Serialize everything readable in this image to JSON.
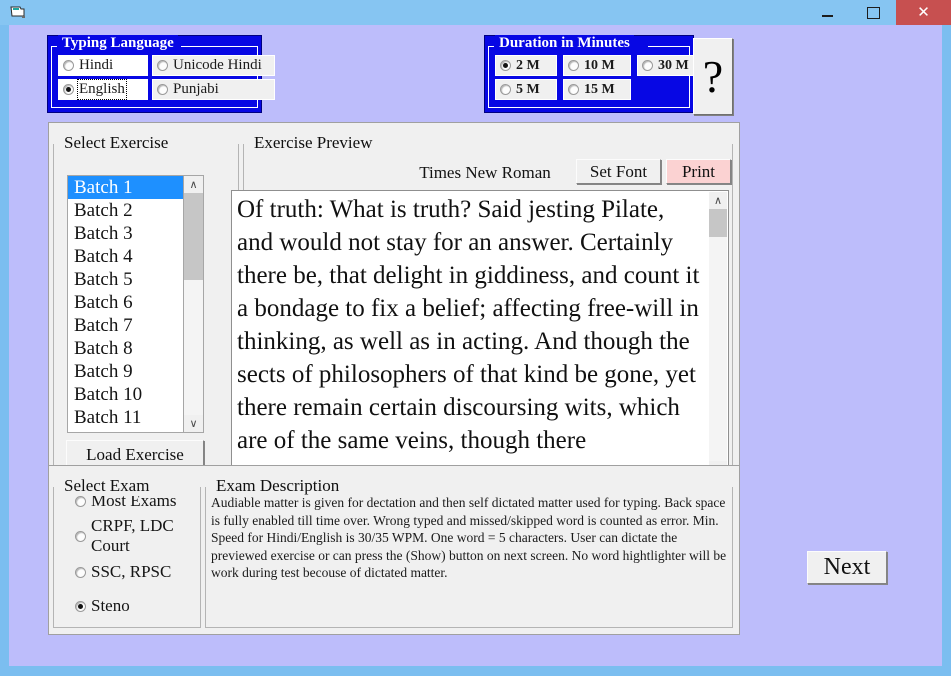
{
  "window": {
    "icon": "window-folder-icon",
    "title": "",
    "minimize_label": "−",
    "maximize_label": "□",
    "close_label": "✕"
  },
  "typing_language": {
    "title": "Typing Language",
    "options": [
      {
        "label": "Hindi",
        "selected": false,
        "focused": false
      },
      {
        "label": "Unicode Hindi",
        "selected": false,
        "focused": false
      },
      {
        "label": "English",
        "selected": true,
        "focused": true
      },
      {
        "label": "Punjabi",
        "selected": false,
        "focused": false
      }
    ]
  },
  "duration": {
    "title": "Duration in Minutes",
    "options": [
      {
        "label": "2 M",
        "selected": true
      },
      {
        "label": "10 M",
        "selected": false
      },
      {
        "label": "30 M",
        "selected": false
      },
      {
        "label": "5 M",
        "selected": false
      },
      {
        "label": "15 M",
        "selected": false
      }
    ]
  },
  "help": {
    "label": "?"
  },
  "select_exercise": {
    "title": "Select Exercise",
    "items": [
      "Batch 1",
      "Batch 2",
      "Batch 3",
      "Batch 4",
      "Batch 5",
      "Batch 6",
      "Batch 7",
      "Batch 8",
      "Batch 9",
      "Batch 10",
      "Batch 11"
    ],
    "selected_index": 0,
    "load_button": "Load Exercise",
    "scroll_up": "∧",
    "scroll_down": "∨"
  },
  "exercise_preview": {
    "title": "Exercise Preview",
    "font_name": "Times New Roman",
    "set_font_button": "Set Font",
    "print_button": "Print",
    "text": "Of truth: What is truth? Said jesting Pilate, and would not stay for an answer. Certainly there be, that delight in giddiness, and count it a bondage to fix a belief; affecting free-will in thinking, as well as in acting. And though the sects of philosophers of that kind be gone, yet there remain certain discoursing wits, which are of the same veins, though there",
    "scroll_up": "∧",
    "scroll_down": "∨"
  },
  "select_exam": {
    "title": "Select Exam",
    "options": [
      {
        "label": "Most Exams",
        "selected": false
      },
      {
        "label": "CRPF, LDC Court",
        "selected": false
      },
      {
        "label": "SSC, RPSC",
        "selected": false
      },
      {
        "label": "Steno",
        "selected": true
      }
    ]
  },
  "exam_description": {
    "title": "Exam Description",
    "text": "Audiable matter is given for dectation and then self dictated matter used for typing. Back space is fully enabled till time over. Wrong typed and missed/skipped word is counted as error. Min. Speed for Hindi/English is 30/35 WPM. One word = 5 characters. User can dictate the previewed exercise or can press the (Show) button on next screen. No word hightlighter will be work during test becouse of dictated matter."
  },
  "next_button": {
    "label": "Next"
  },
  "colors": {
    "titlebar": "#86c5f2",
    "close_button": "#c75050",
    "form_background": "#bdbdfb",
    "group_blue": "#0707e4",
    "panel": "#f0f0f0",
    "list_selection": "#1e90ff",
    "print_button": "#fbd2d2"
  }
}
